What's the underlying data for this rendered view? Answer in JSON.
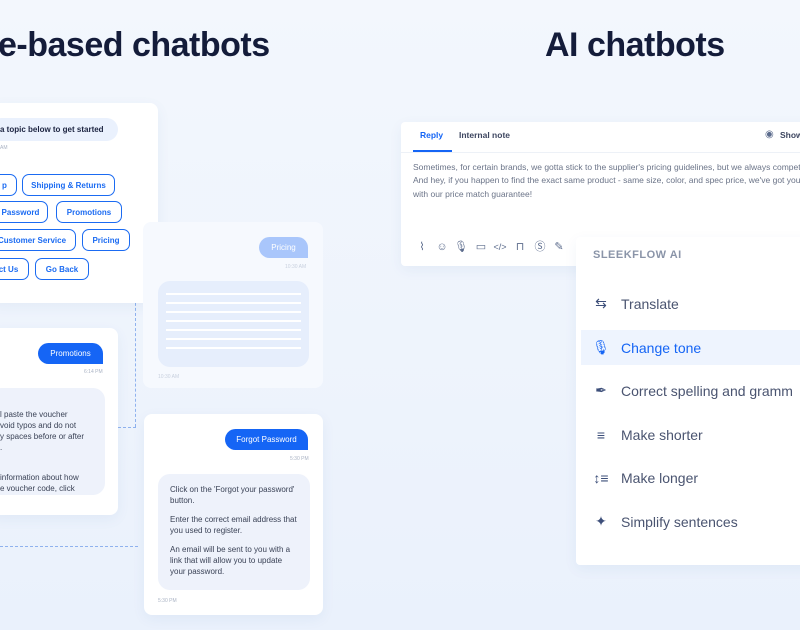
{
  "left": {
    "title": "e-based chatbots",
    "menu_card": {
      "prompt": "a topic below to get started",
      "timestamp": "AM",
      "options": [
        "p",
        "Shipping & Returns",
        "t Password",
        "Promotions",
        "Customer Service",
        "Pricing",
        "ct Us",
        "Go Back"
      ]
    },
    "pricing_card": {
      "user_message": "Pricing",
      "timestamp_user": "10:30 AM",
      "timestamp_bot": "10:30 AM"
    },
    "promotions_card": {
      "user_message": "Promotions",
      "timestamp": "6:14 PM",
      "bot_paragraphs": [
        "l paste the voucher\nvoid typos and do not\ny spaces before or after\n.",
        "information about how\ne voucher code, click"
      ]
    },
    "password_card": {
      "user_message": "Forgot Password",
      "timestamp_user": "5:30 PM",
      "bot_paragraphs": [
        "Click on the 'Forgot your password' button.",
        "Enter the correct email address that you used to register.",
        "An email will be sent to you with a link that will allow you to update your password."
      ],
      "timestamp_bot": "5:30 PM"
    }
  },
  "right": {
    "title": "AI chatbots",
    "composer": {
      "tabs": [
        {
          "label": "Reply",
          "active": true
        },
        {
          "label": "Internal note",
          "active": false
        }
      ],
      "show_label": "Show",
      "message": "Sometimes, for certain brands, we gotta stick to the supplier's pricing guidelines, but we always competitive. And hey, if you happen to find the exact same product - same size, color, and spec price, we've got your back with our price match guarantee!",
      "toolbar_icons": [
        "paperclip-icon",
        "emoji-icon",
        "microphone-icon",
        "message-icon",
        "code-icon",
        "bag-icon",
        "dollar-icon",
        "magic-wand-icon"
      ]
    },
    "ai_menu": {
      "header": "SLEEKFLOW AI",
      "items": [
        {
          "label": "Translate",
          "icon": "swap-icon"
        },
        {
          "label": "Change tone",
          "icon": "microphone-icon",
          "active": true
        },
        {
          "label": "Correct spelling and gramm",
          "icon": "pen-icon"
        },
        {
          "label": "Make shorter",
          "icon": "lines-icon"
        },
        {
          "label": "Make longer",
          "icon": "expand-lines-icon"
        },
        {
          "label": "Simplify sentences",
          "icon": "sparkle-icon"
        }
      ]
    }
  },
  "colors": {
    "accent": "#1565f5",
    "title": "#141c3a",
    "bubble_light": "#eef2fb"
  }
}
